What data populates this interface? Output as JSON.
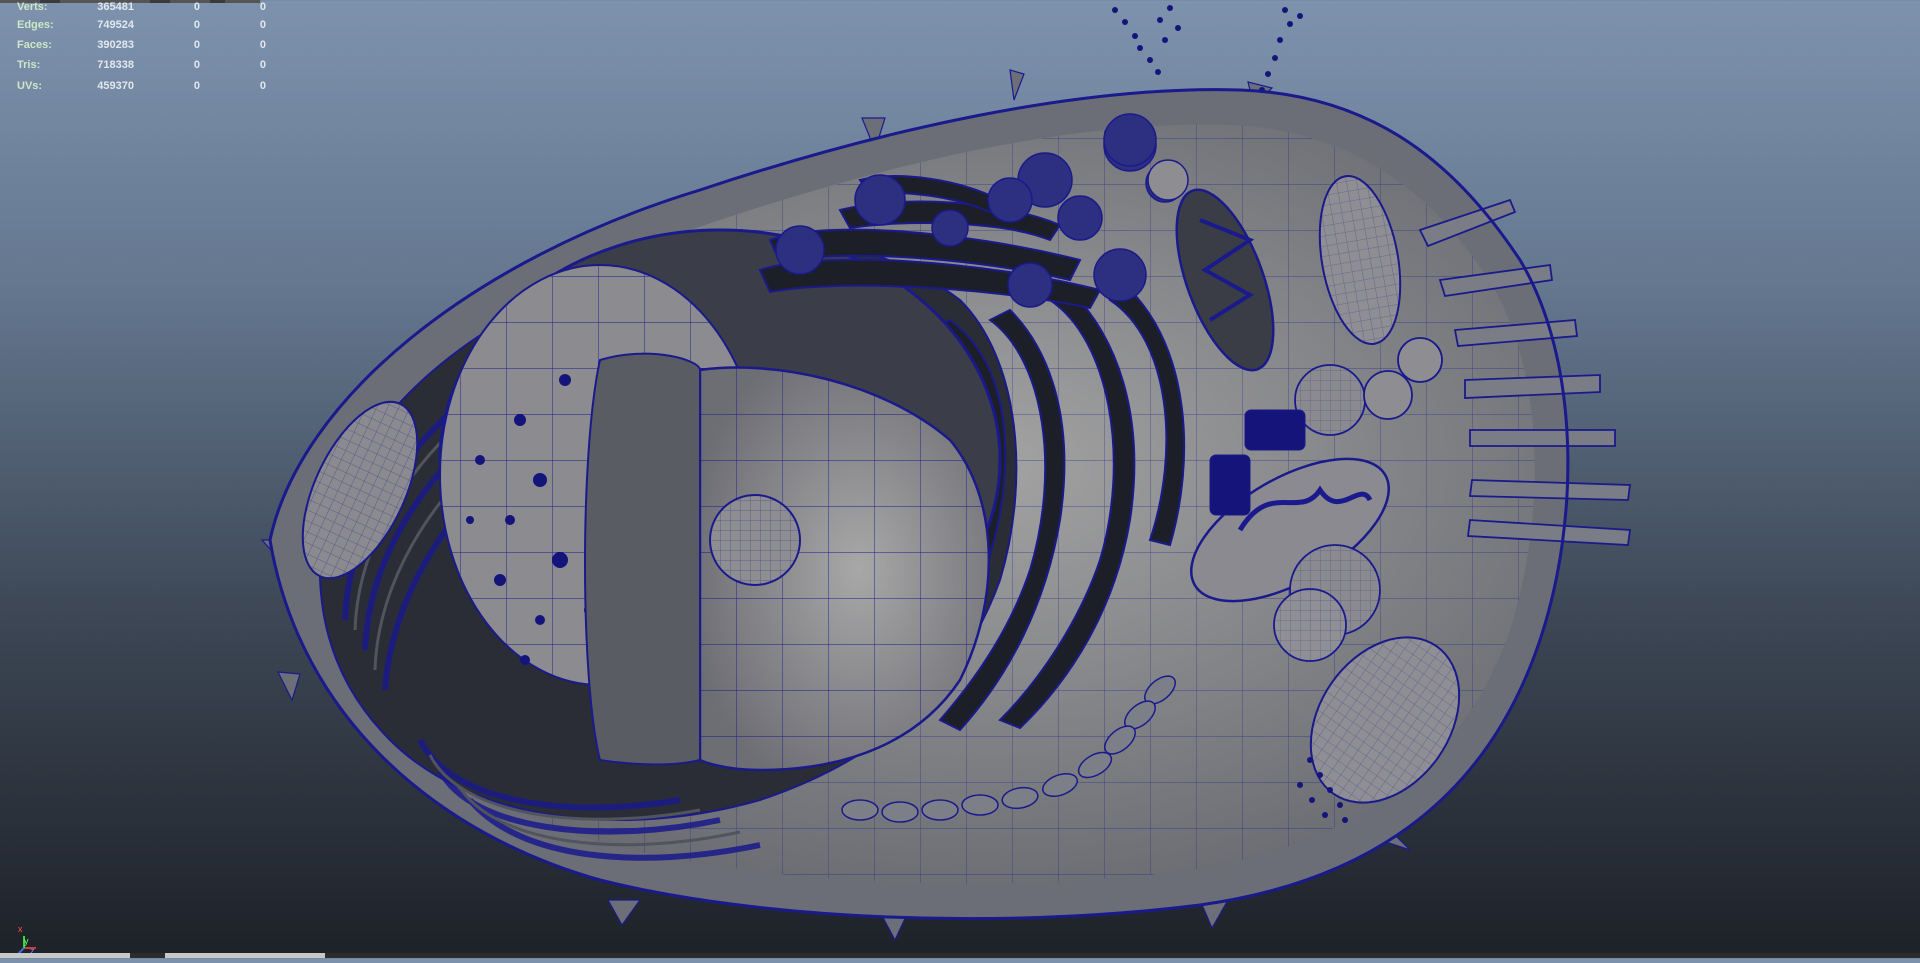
{
  "poly_count": {
    "rows": [
      {
        "label": "Verts:",
        "values": [
          "365481",
          "0",
          "0"
        ]
      },
      {
        "label": "Edges:",
        "values": [
          "749524",
          "0",
          "0"
        ]
      },
      {
        "label": "Faces:",
        "values": [
          "390283",
          "0",
          "0"
        ]
      },
      {
        "label": "Tris:",
        "values": [
          "718338",
          "0",
          "0"
        ]
      },
      {
        "label": "UVs:",
        "values": [
          "459370",
          "0",
          "0"
        ]
      }
    ]
  },
  "axis_gizmo": {
    "x": "x",
    "y": "y",
    "z": "z"
  },
  "colors": {
    "hud_label": "#cde8c6",
    "hud_value": "#e2e8ee",
    "wireframe": "#1a1a8c",
    "mesh_shaded": "#8e8e8e",
    "mesh_dark": "#2a2d36",
    "background_top": "#7d92ad",
    "background_bottom": "#1d2128"
  },
  "scene": {
    "object": "cell-model",
    "mode": "wireframe-on-shaded",
    "icons": [
      "axis-gizmo-icon"
    ]
  }
}
